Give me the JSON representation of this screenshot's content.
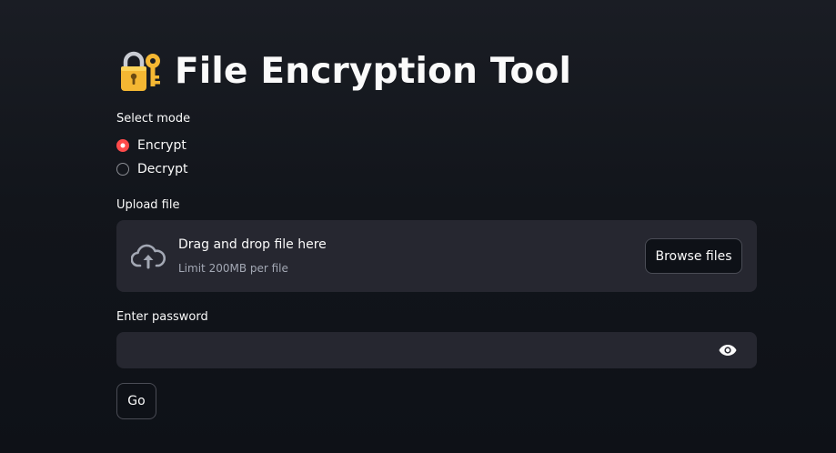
{
  "header": {
    "icon": "locked-with-key-icon",
    "title": "File Encryption Tool"
  },
  "mode": {
    "label": "Select mode",
    "options": [
      {
        "label": "Encrypt",
        "checked": true
      },
      {
        "label": "Decrypt",
        "checked": false
      }
    ]
  },
  "upload": {
    "label": "Upload file",
    "icon": "cloud-upload-icon",
    "title": "Drag and drop file here",
    "subtitle": "Limit 200MB per file",
    "browse_label": "Browse files"
  },
  "password": {
    "label": "Enter password",
    "value": "",
    "placeholder": "",
    "icon": "eye-icon"
  },
  "submit": {
    "label": "Go"
  },
  "colors": {
    "background": "#0e1117",
    "surface": "#262730",
    "accent": "#ff4b4b",
    "text": "#fafafa",
    "muted": "#a3a8b4"
  }
}
